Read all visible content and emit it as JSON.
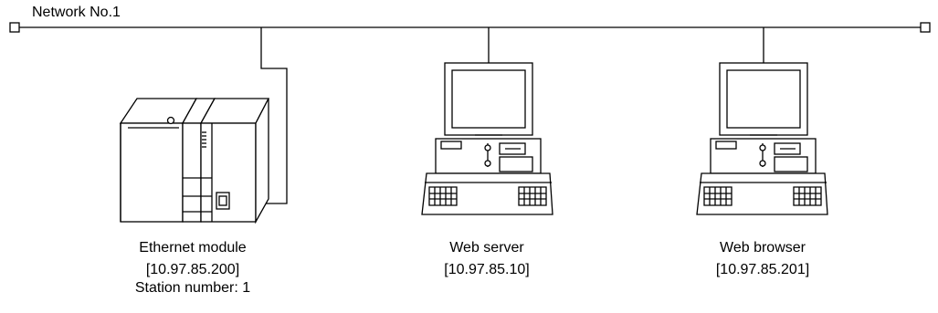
{
  "network": {
    "label": "Network No.1"
  },
  "devices": [
    {
      "name": "Ethernet module",
      "ip": "[10.97.85.200]",
      "station": "Station number: 1"
    },
    {
      "name": "Web server",
      "ip": "[10.97.85.10]"
    },
    {
      "name": "Web browser",
      "ip": "[10.97.85.201]"
    }
  ],
  "colors": {
    "line": "#000000",
    "background": "#ffffff"
  },
  "icons": {
    "ethernet_module": "plc-module-icon",
    "web_server": "computer-icon",
    "web_browser": "computer-icon"
  }
}
